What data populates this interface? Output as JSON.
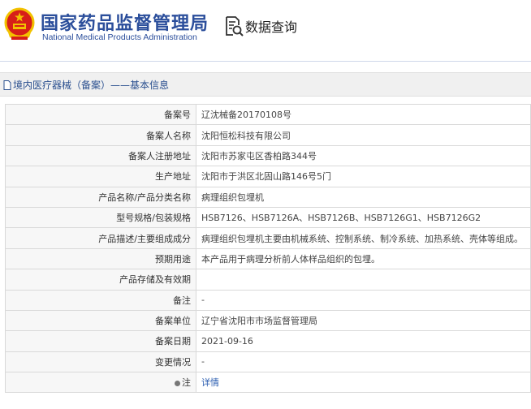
{
  "header": {
    "org_cn": "国家药品监督管理局",
    "org_en": "National Medical Products Administration",
    "query_label": "数据查询"
  },
  "breadcrumb": "境内医疗器械（备案）——基本信息",
  "rows": [
    {
      "key": "备案号",
      "value": "辽沈械备20170108号"
    },
    {
      "key": "备案人名称",
      "value": "沈阳恒松科技有限公司"
    },
    {
      "key": "备案人注册地址",
      "value": "沈阳市苏家屯区香柏路344号"
    },
    {
      "key": "生产地址",
      "value": "沈阳市于洪区北固山路146号5门"
    },
    {
      "key": "产品名称/产品分类名称",
      "value": "病理组织包埋机"
    },
    {
      "key": "型号规格/包装规格",
      "value": "HSB7126、HSB7126A、HSB7126B、HSB7126G1、HSB7126G2"
    },
    {
      "key": "产品描述/主要组成成分",
      "value": "病理组织包埋机主要由机械系统、控制系统、制冷系统、加热系统、壳体等组成。"
    },
    {
      "key": "预期用途",
      "value": "本产品用于病理分析前人体样品组织的包埋。"
    },
    {
      "key": "产品存储及有效期",
      "value": ""
    },
    {
      "key": "备注",
      "value": "-"
    },
    {
      "key": "备案单位",
      "value": "辽宁省沈阳市市场监督管理局"
    },
    {
      "key": "备案日期",
      "value": "2021-09-16"
    },
    {
      "key": "变更情况",
      "value": "-"
    },
    {
      "key": "注",
      "value": "详情"
    }
  ],
  "colors": {
    "brand": "#2b4e9b",
    "link": "#2a5db0",
    "emblem_red": "#d71e19",
    "emblem_gold": "#f2c200"
  },
  "icons": {
    "emblem": "national-emblem-icon",
    "query": "document-search-icon",
    "crumb": "document-icon",
    "note": "pin-icon"
  }
}
